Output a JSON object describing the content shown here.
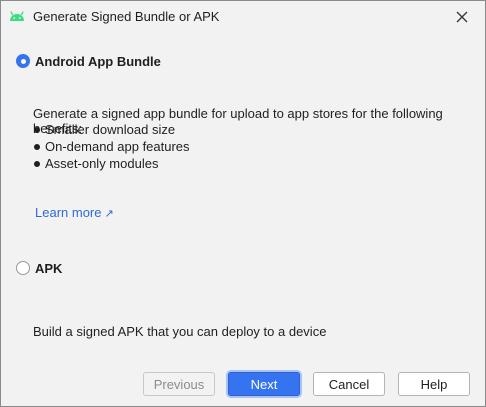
{
  "window": {
    "title": "Generate Signed Bundle or APK",
    "icon": "android-icon",
    "accent": "#3574f0"
  },
  "options": {
    "bundle": {
      "label": "Android App Bundle",
      "selected": true,
      "description": "Generate a signed app bundle for upload to app stores for the following benefits:",
      "benefits": [
        "Smaller download size",
        "On-demand app features",
        "Asset-only modules"
      ],
      "learn_more": "Learn more",
      "learn_more_icon": "external-link-icon"
    },
    "apk": {
      "label": "APK",
      "selected": false,
      "description": "Build a signed APK that you can deploy to a device"
    }
  },
  "buttons": {
    "previous": "Previous",
    "next": "Next",
    "cancel": "Cancel",
    "help": "Help"
  }
}
